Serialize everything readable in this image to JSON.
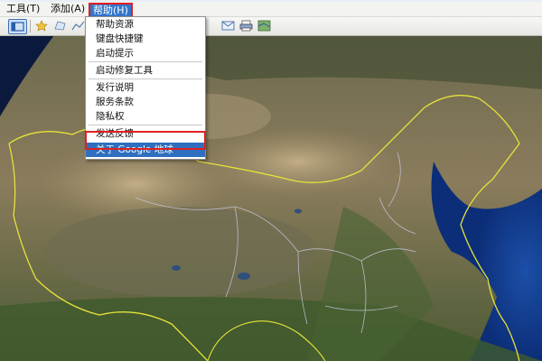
{
  "menubar": {
    "tools": "工具(T)",
    "add": "添加(A)",
    "help": "帮助(H)"
  },
  "toolbar": {
    "icons": [
      "sidebar-icon",
      "placemark-icon",
      "polygon-icon",
      "path-icon",
      "email-icon",
      "print-icon",
      "map-view-icon"
    ]
  },
  "help_menu": {
    "items": [
      {
        "label": "帮助资源"
      },
      {
        "label": "键盘快捷键"
      },
      {
        "label": "启动提示"
      },
      {
        "label": "启动修复工具"
      },
      {
        "label": "发行说明"
      },
      {
        "label": "服务条款"
      },
      {
        "label": "隐私权"
      },
      {
        "label": "发送反馈"
      },
      {
        "label": "关于 Google 地球"
      }
    ]
  },
  "colors": {
    "menu_highlight": "#3377cc",
    "annotation_box": "#e02020",
    "border_line": "#e6e23a",
    "province_line": "#c9c9dd"
  }
}
